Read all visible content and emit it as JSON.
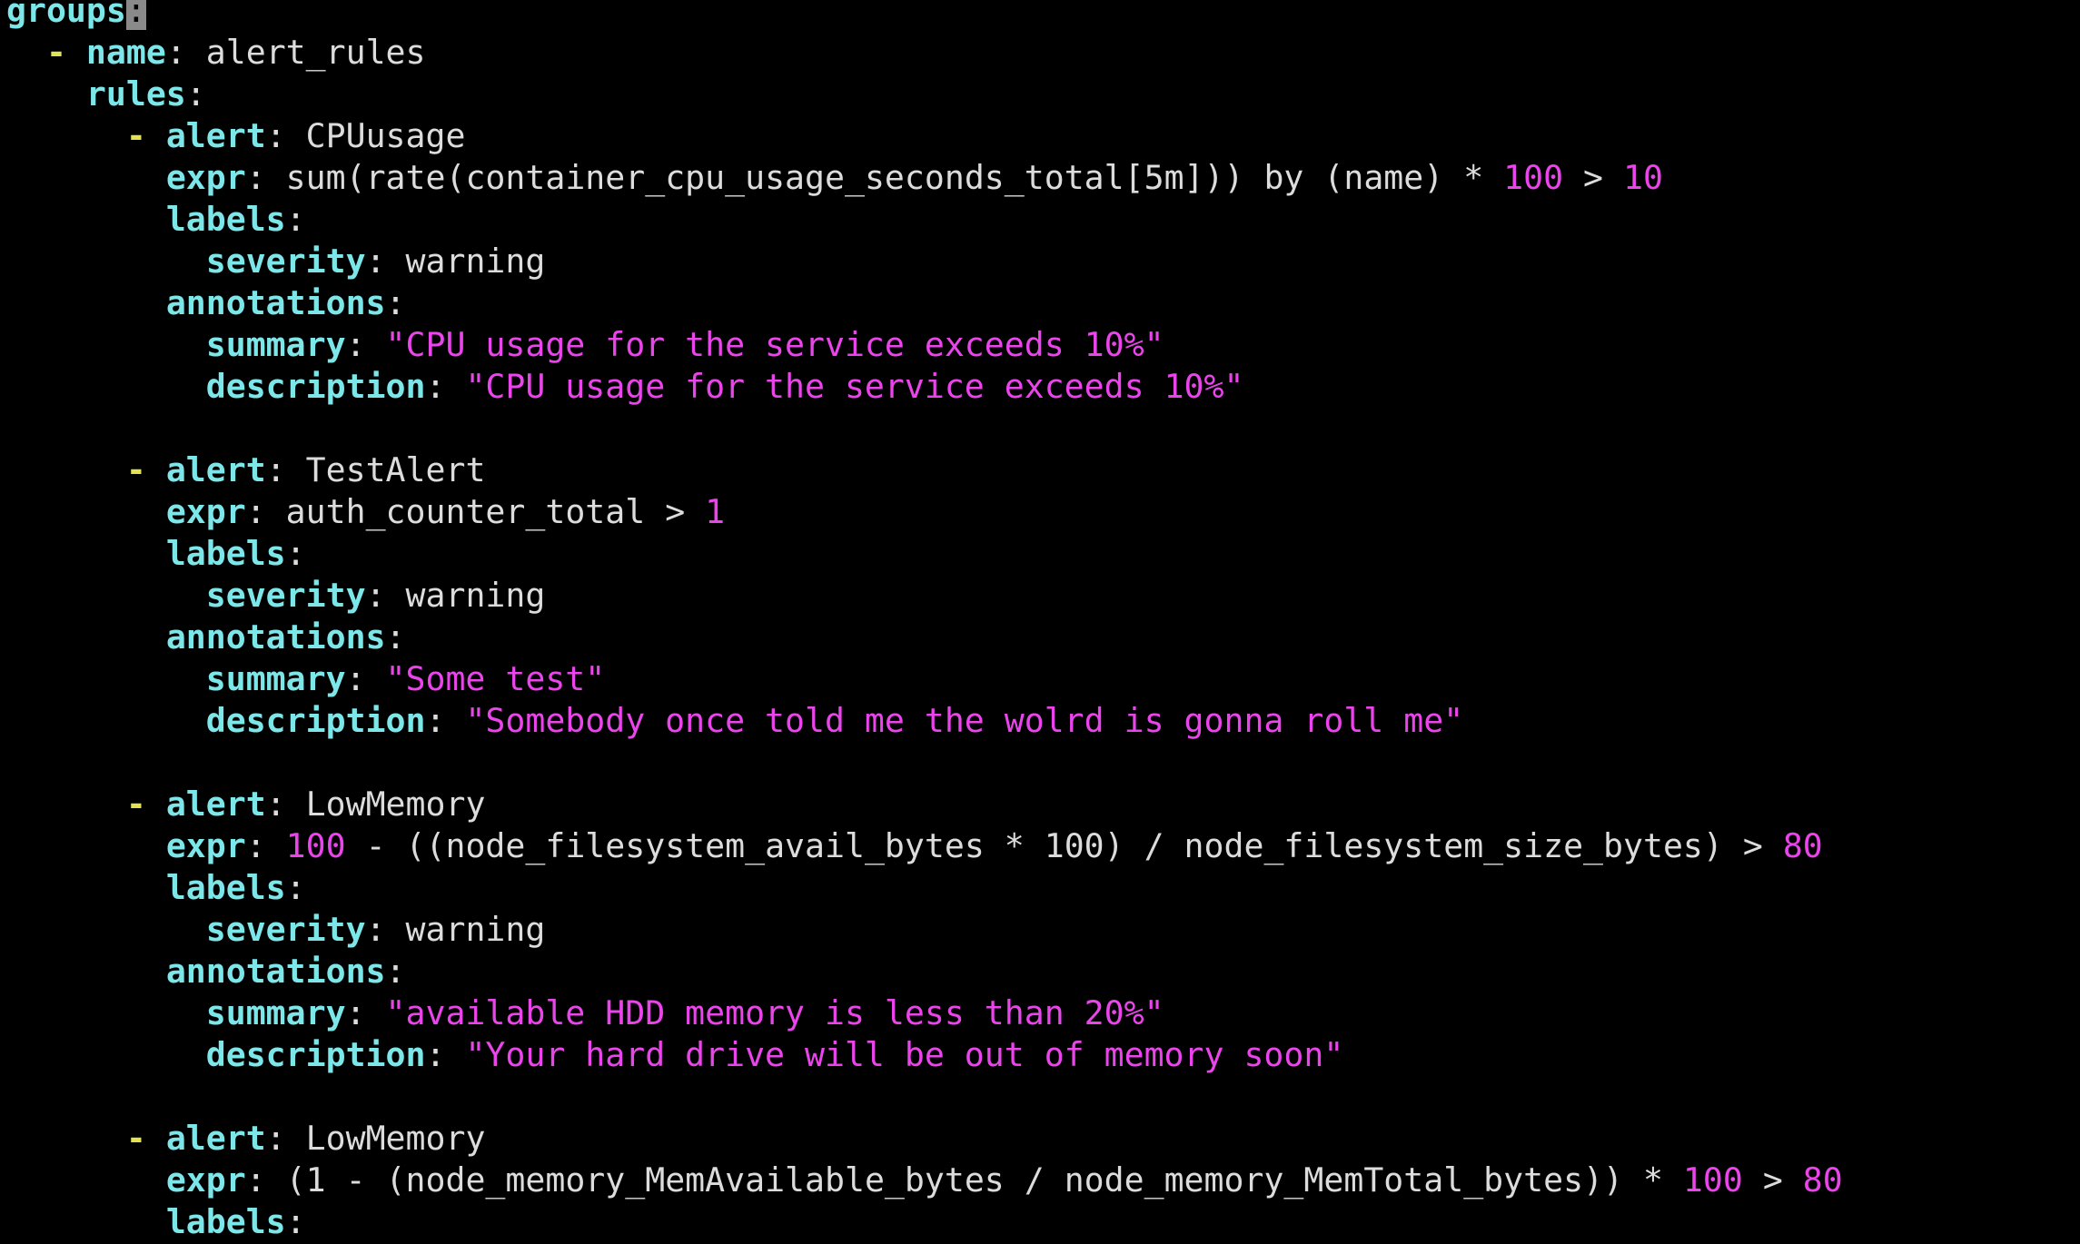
{
  "editor": {
    "cursor_char": ":",
    "lines": [
      {
        "indent": "",
        "dash": "",
        "key": "groups",
        "sep": ":",
        "cursor": true,
        "value": []
      },
      {
        "indent": "  ",
        "dash": "- ",
        "key": "name",
        "sep": ": ",
        "value": [
          {
            "t": "val",
            "x": "alert_rules"
          }
        ]
      },
      {
        "indent": "    ",
        "dash": "",
        "key": "rules",
        "sep": ":",
        "value": []
      },
      {
        "indent": "      ",
        "dash": "- ",
        "key": "alert",
        "sep": ": ",
        "value": [
          {
            "t": "val",
            "x": "CPUusage"
          }
        ]
      },
      {
        "indent": "        ",
        "dash": "",
        "key": "expr",
        "sep": ": ",
        "value": [
          {
            "t": "val",
            "x": "sum(rate(container_cpu_usage_seconds_total[5m])) by (name) * "
          },
          {
            "t": "num",
            "x": "100"
          },
          {
            "t": "val",
            "x": " > "
          },
          {
            "t": "num",
            "x": "10"
          }
        ]
      },
      {
        "indent": "        ",
        "dash": "",
        "key": "labels",
        "sep": ":",
        "value": []
      },
      {
        "indent": "          ",
        "dash": "",
        "key": "severity",
        "sep": ": ",
        "value": [
          {
            "t": "val",
            "x": "warning"
          }
        ]
      },
      {
        "indent": "        ",
        "dash": "",
        "key": "annotations",
        "sep": ":",
        "value": []
      },
      {
        "indent": "          ",
        "dash": "",
        "key": "summary",
        "sep": ": ",
        "value": [
          {
            "t": "str",
            "x": "\"CPU usage for the service exceeds 10%\""
          }
        ]
      },
      {
        "indent": "          ",
        "dash": "",
        "key": "description",
        "sep": ": ",
        "value": [
          {
            "t": "str",
            "x": "\"CPU usage for the service exceeds 10%\""
          }
        ]
      },
      {
        "blank": true
      },
      {
        "indent": "      ",
        "dash": "- ",
        "key": "alert",
        "sep": ": ",
        "value": [
          {
            "t": "val",
            "x": "TestAlert"
          }
        ]
      },
      {
        "indent": "        ",
        "dash": "",
        "key": "expr",
        "sep": ": ",
        "value": [
          {
            "t": "val",
            "x": "auth_counter_total > "
          },
          {
            "t": "num",
            "x": "1"
          }
        ]
      },
      {
        "indent": "        ",
        "dash": "",
        "key": "labels",
        "sep": ":",
        "value": []
      },
      {
        "indent": "          ",
        "dash": "",
        "key": "severity",
        "sep": ": ",
        "value": [
          {
            "t": "val",
            "x": "warning"
          }
        ]
      },
      {
        "indent": "        ",
        "dash": "",
        "key": "annotations",
        "sep": ":",
        "value": []
      },
      {
        "indent": "          ",
        "dash": "",
        "key": "summary",
        "sep": ": ",
        "value": [
          {
            "t": "str",
            "x": "\"Some test\""
          }
        ]
      },
      {
        "indent": "          ",
        "dash": "",
        "key": "description",
        "sep": ": ",
        "value": [
          {
            "t": "str",
            "x": "\"Somebody once told me the wolrd is gonna roll me\""
          }
        ]
      },
      {
        "blank": true
      },
      {
        "indent": "      ",
        "dash": "- ",
        "key": "alert",
        "sep": ": ",
        "value": [
          {
            "t": "val",
            "x": "LowMemory"
          }
        ]
      },
      {
        "indent": "        ",
        "dash": "",
        "key": "expr",
        "sep": ": ",
        "value": [
          {
            "t": "num",
            "x": "100"
          },
          {
            "t": "val",
            "x": " - ((node_filesystem_avail_bytes * 100) / node_filesystem_size_bytes) > "
          },
          {
            "t": "num",
            "x": "80"
          }
        ]
      },
      {
        "indent": "        ",
        "dash": "",
        "key": "labels",
        "sep": ":",
        "value": []
      },
      {
        "indent": "          ",
        "dash": "",
        "key": "severity",
        "sep": ": ",
        "value": [
          {
            "t": "val",
            "x": "warning"
          }
        ]
      },
      {
        "indent": "        ",
        "dash": "",
        "key": "annotations",
        "sep": ":",
        "value": []
      },
      {
        "indent": "          ",
        "dash": "",
        "key": "summary",
        "sep": ": ",
        "value": [
          {
            "t": "str",
            "x": "\"available HDD memory is less than 20%\""
          }
        ]
      },
      {
        "indent": "          ",
        "dash": "",
        "key": "description",
        "sep": ": ",
        "value": [
          {
            "t": "str",
            "x": "\"Your hard drive will be out of memory soon\""
          }
        ]
      },
      {
        "blank": true
      },
      {
        "indent": "      ",
        "dash": "- ",
        "key": "alert",
        "sep": ": ",
        "value": [
          {
            "t": "val",
            "x": "LowMemory"
          }
        ]
      },
      {
        "indent": "        ",
        "dash": "",
        "key": "expr",
        "sep": ": ",
        "value": [
          {
            "t": "val",
            "x": "(1 - (node_memory_MemAvailable_bytes / node_memory_MemTotal_bytes)) * "
          },
          {
            "t": "num",
            "x": "100"
          },
          {
            "t": "val",
            "x": " > "
          },
          {
            "t": "num",
            "x": "80"
          }
        ]
      },
      {
        "indent": "        ",
        "dash": "",
        "key": "labels",
        "sep": ":",
        "value": []
      }
    ]
  }
}
